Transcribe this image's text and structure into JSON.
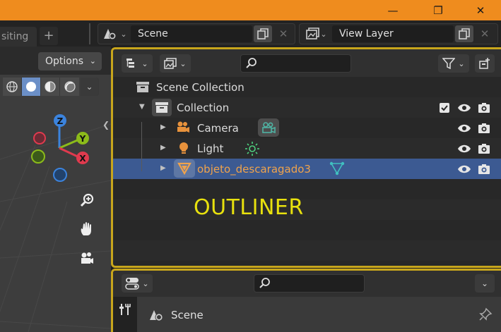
{
  "window": {
    "minimize_glyph": "—",
    "restore_glyph": "❐",
    "close_glyph": "✕"
  },
  "workspace": {
    "tab_partial_label": "siting",
    "add_tab_label": "+"
  },
  "scene_selector": {
    "value": "Scene"
  },
  "view_layer_selector": {
    "value": "View Layer"
  },
  "viewport": {
    "options_label": "Options",
    "gizmo": {
      "z_label": "Z",
      "y_label": "Y",
      "x_label": "X"
    }
  },
  "outliner": {
    "panel_caption": "OUTLINER",
    "rows": [
      {
        "label": "Scene Collection",
        "type": "scene-collection"
      },
      {
        "label": "Collection",
        "type": "collection",
        "checked": true
      },
      {
        "label": "Camera",
        "type": "camera"
      },
      {
        "label": "Light",
        "type": "light"
      },
      {
        "label": "objeto_descaragado3",
        "type": "mesh",
        "selected": true
      }
    ]
  },
  "properties": {
    "context_label": "Scene"
  },
  "colors": {
    "title_bar": "#ef8c1e",
    "panel_highlight": "#c8a61c",
    "selected_row": "#3c5a92",
    "selected_text": "#f0a34b",
    "camera_data": "#4fb3a3",
    "light_data": "#4ed07f",
    "mesh_data": "#40c0c0",
    "caption": "#e8e10e",
    "gizmo_x": "#e03a4e",
    "gizmo_y": "#8cbb1a",
    "gizmo_z": "#3b83dd"
  }
}
